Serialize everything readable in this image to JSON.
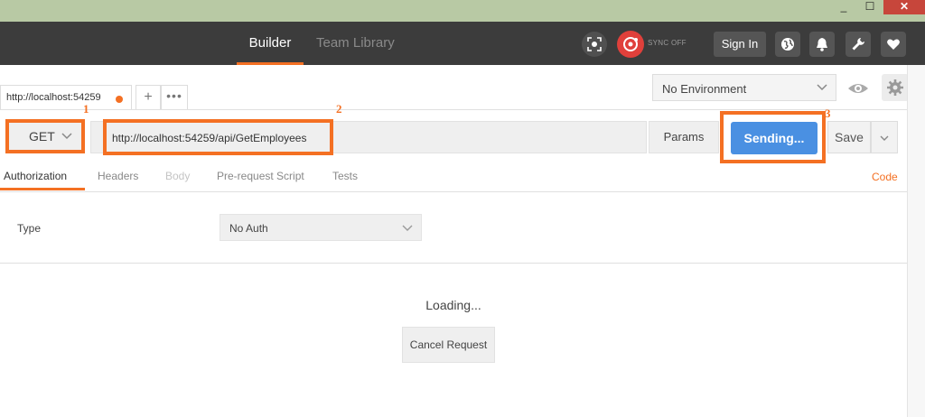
{
  "window": {
    "min_glyph": "_",
    "max_glyph": "☐",
    "close_glyph": "✕"
  },
  "header": {
    "tabs": [
      {
        "label": "Builder",
        "active": true
      },
      {
        "label": "Team Library",
        "active": false
      }
    ],
    "sync_label": "SYNC OFF",
    "signin_label": "Sign In",
    "icons": [
      "capture-icon",
      "sync-icon",
      "globe-icon",
      "bell-icon",
      "wrench-icon",
      "heart-icon"
    ],
    "accent_color": "#f47023",
    "bar_color": "#3c3c3c"
  },
  "request_tabs": {
    "items": [
      {
        "label": "http://localhost:54259",
        "unsaved": true
      }
    ],
    "add_label": "+",
    "more_label": "•••"
  },
  "environment": {
    "selected": "No Environment",
    "icons": [
      "eye-icon",
      "gear-icon"
    ]
  },
  "request": {
    "method": "GET",
    "url": "http://localhost:54259/api/GetEmployees",
    "params_label": "Params",
    "send_label": "Sending...",
    "save_label": "Save",
    "send_color": "#4a90e2"
  },
  "annotations": [
    "1",
    "2",
    "3"
  ],
  "subtabs": {
    "items": [
      {
        "label": "Authorization",
        "active": true,
        "disabled": false
      },
      {
        "label": "Headers",
        "active": false,
        "disabled": false
      },
      {
        "label": "Body",
        "active": false,
        "disabled": true
      },
      {
        "label": "Pre-request Script",
        "active": false,
        "disabled": false
      },
      {
        "label": "Tests",
        "active": false,
        "disabled": false
      }
    ],
    "code_label": "Code"
  },
  "auth": {
    "type_label": "Type",
    "selected": "No Auth"
  },
  "response": {
    "loading_text": "Loading...",
    "cancel_label": "Cancel Request"
  }
}
